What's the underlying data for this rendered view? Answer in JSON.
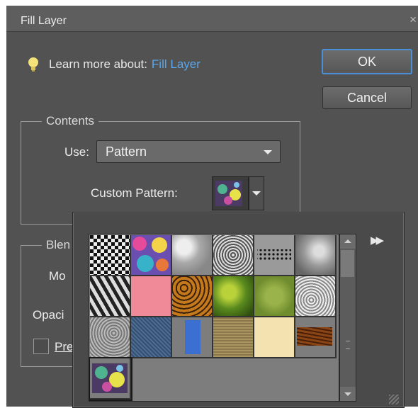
{
  "dialog": {
    "title": "Fill Layer",
    "close_glyph": "×",
    "learn_prefix": "Learn more about:",
    "learn_link": "Fill Layer"
  },
  "buttons": {
    "ok": "OK",
    "cancel": "Cancel"
  },
  "contents": {
    "legend": "Contents",
    "use_label": "Use:",
    "use_value": "Pattern",
    "custom_pattern_label": "Custom Pattern:"
  },
  "blending": {
    "legend": "Blen",
    "mode_label": "Mo",
    "opacity_label": "Opaci",
    "preserve_label": "Pre"
  },
  "picker": {
    "menu_glyph": "▶▶",
    "patterns": [
      {
        "name": "checker-pattern"
      },
      {
        "name": "colorful-pattern"
      },
      {
        "name": "clouds-pattern"
      },
      {
        "name": "noise-pattern"
      },
      {
        "name": "dots-pattern"
      },
      {
        "name": "gray-clouds-pattern"
      },
      {
        "name": "zebra-pattern"
      },
      {
        "name": "pink-pattern"
      },
      {
        "name": "leopard-pattern"
      },
      {
        "name": "leaves-pattern"
      },
      {
        "name": "moss-pattern"
      },
      {
        "name": "granite-pattern"
      },
      {
        "name": "gray-stone-pattern"
      },
      {
        "name": "denim-pattern"
      },
      {
        "name": "blue-pattern"
      },
      {
        "name": "burlap-pattern"
      },
      {
        "name": "parchment-pattern"
      },
      {
        "name": "wood-pattern"
      },
      {
        "name": "custom-pattern"
      }
    ]
  }
}
